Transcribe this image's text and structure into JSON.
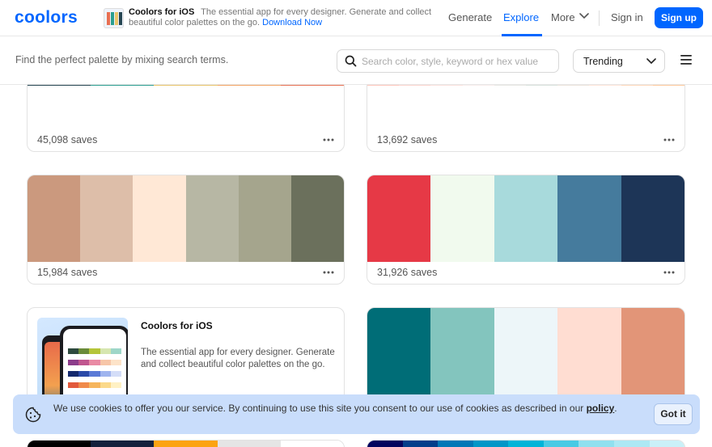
{
  "header": {
    "logo": "coolors",
    "promo": {
      "title": "Coolors for iOS",
      "text": "The essential app for every designer. Generate and collect beautiful color palettes on the go.",
      "link": "Download Now"
    },
    "nav": {
      "generate": "Generate",
      "explore": "Explore",
      "more": "More",
      "sign_in": "Sign in",
      "sign_up": "Sign up"
    }
  },
  "searchbar": {
    "hint": "Find the perfect palette by mixing search terms.",
    "placeholder": "Search color, style, keyword or hex value",
    "sort": "Trending"
  },
  "palettes": [
    {
      "saves": "45,098 saves",
      "colors": [
        "#264653",
        "#2a9d8f",
        "#e9c46a",
        "#f4a261",
        "#e76f51"
      ]
    },
    {
      "saves": "13,692 saves",
      "colors": [
        "#fec5bb",
        "#fcd5ce",
        "#fae1dd",
        "#f8edeb",
        "#e8e8e4",
        "#d8e2dc",
        "#ece4db",
        "#ffe5d9",
        "#ffd7ba",
        "#fec89a"
      ]
    },
    {
      "saves": "15,984 saves",
      "colors": [
        "#cb997e",
        "#ddbea9",
        "#ffe8d6",
        "#b7b7a4",
        "#a5a58d",
        "#6b705c"
      ]
    },
    {
      "saves": "31,926 saves",
      "colors": [
        "#e63946",
        "#f1faee",
        "#a8dadc",
        "#457b9d",
        "#1d3557"
      ]
    },
    {
      "saves": "",
      "colors": [
        "#006d77",
        "#83c5be",
        "#edf6f9",
        "#ffddd2",
        "#e29578"
      ]
    },
    {
      "saves": "",
      "colors": [
        "#000000",
        "#14213d",
        "#fca311",
        "#e5e5e5",
        "#ffffff"
      ]
    },
    {
      "saves": "",
      "colors": [
        "#03045e",
        "#023e8a",
        "#0077b6",
        "#0096c7",
        "#00b4d8",
        "#48cae4",
        "#90e0ef",
        "#ade8f4",
        "#caf0f8"
      ]
    }
  ],
  "ios_card": {
    "title": "Coolors for iOS",
    "description": "The essential app for every designer. Generate and collect beautiful color palettes on the go."
  },
  "cookie": {
    "text": "We use cookies to offer you our service. By continuing to use this site you consent to our use of cookies as described in our",
    "policy_link": "policy",
    "suffix": ".",
    "button": "Got it"
  },
  "colors": {
    "accent": "#0066ff",
    "cookie_bg": "#c9ddfb"
  },
  "icons": {
    "search": "search-icon",
    "menu": "hamburger-menu-icon",
    "more": "more-dots-icon",
    "cookie": "cookie-icon",
    "chevron": "chevron-down-icon"
  }
}
